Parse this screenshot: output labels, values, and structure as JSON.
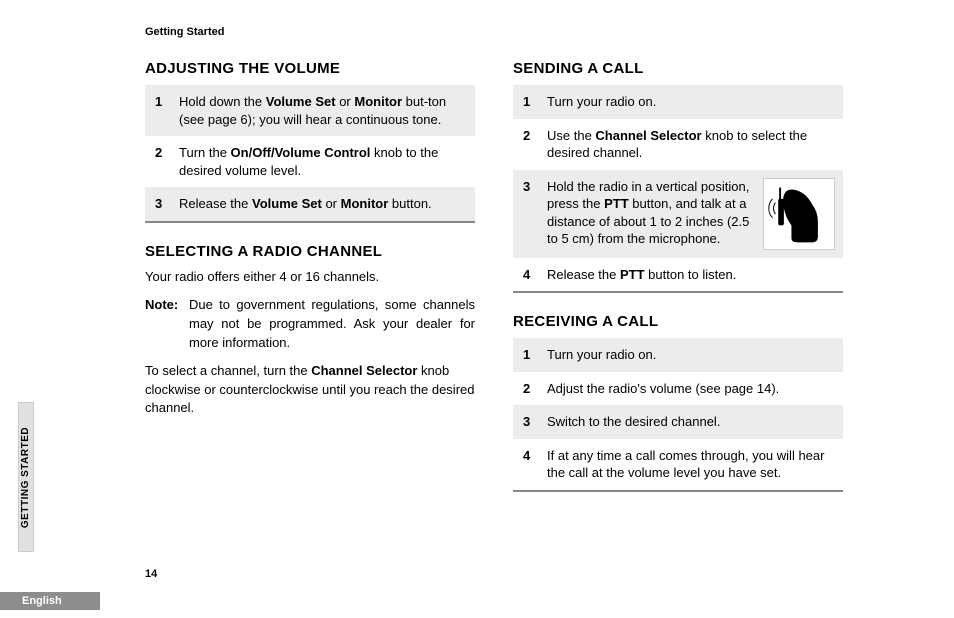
{
  "header": "Getting Started",
  "side_tab": "GETTING STARTED",
  "page_number": "14",
  "language": "English",
  "left": {
    "section1": {
      "title": "ADJUSTING THE VOLUME",
      "steps": [
        {
          "n": "1",
          "pre": "Hold down the ",
          "b1": "Volume Set",
          "mid1": " or ",
          "b2": "Monitor",
          "mid2": " but-ton ",
          "post": "(see page 6); you will hear a continuous tone."
        },
        {
          "n": "2",
          "pre": "Turn the ",
          "b1": "On/Off/Volume Control",
          "post": " knob to the desired volume level."
        },
        {
          "n": "3",
          "pre": "Release the ",
          "b1": "Volume Set",
          "mid1": " or ",
          "b2": "Monitor",
          "post": " button."
        }
      ]
    },
    "section2": {
      "title": "SELECTING A RADIO CHANNEL",
      "intro": "Your radio offers either 4 or 16 channels.",
      "note_label": "Note:",
      "note_body": "Due to government regulations, some channels may not be programmed. Ask your dealer for more information.",
      "para2_pre": "To select a channel, turn the ",
      "para2_b": "Channel Selector",
      "para2_post": " knob clockwise or counterclockwise until you reach the desired channel."
    }
  },
  "right": {
    "section1": {
      "title": "SENDING A CALL",
      "steps": [
        {
          "n": "1",
          "text": "Turn your radio on."
        },
        {
          "n": "2",
          "pre": "Use the ",
          "b1": "Channel Selector",
          "post": " knob to select the desired channel."
        },
        {
          "n": "3",
          "pre": "Hold the radio in a vertical position, press the ",
          "b1": "PTT",
          "post": " button, and talk at a distance of about 1 to 2 inches (2.5 to 5 cm) from the microphone.",
          "has_image": true
        },
        {
          "n": "4",
          "pre": "Release the ",
          "b1": "PTT",
          "post": " button to listen."
        }
      ]
    },
    "section2": {
      "title": "RECEIVING A CALL",
      "steps": [
        {
          "n": "1",
          "text": "Turn your radio on."
        },
        {
          "n": "2",
          "text": "Adjust the radio's volume (see page 14)."
        },
        {
          "n": "3",
          "text": "Switch to the desired channel."
        },
        {
          "n": "4",
          "text": "If at any time a call comes through, you will hear the call at the volume level you have set."
        }
      ]
    }
  }
}
